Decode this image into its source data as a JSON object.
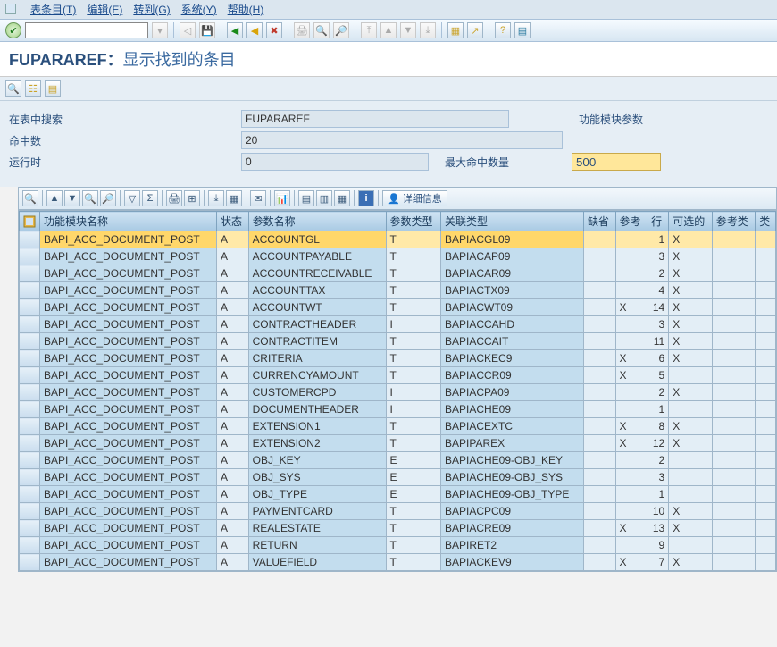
{
  "menu": {
    "items": [
      "表条目(T)",
      "编辑(E)",
      "转到(G)",
      "系统(Y)",
      "帮助(H)"
    ]
  },
  "title": {
    "name": "FUPARAREF：",
    "suffix": "显示找到的条目"
  },
  "form": {
    "search_label": "在表中搜索",
    "search_value": "FUPARAREF",
    "search_note": "功能模块参数",
    "hits_label": "命中数",
    "hits_value": "20",
    "runtime_label": "运行时",
    "runtime_value": "0",
    "maxhits_label": "最大命中数量",
    "maxhits_value": "500"
  },
  "alv_toolbar": {
    "detail_label": "详细信息"
  },
  "columns": [
    "功能模块名称",
    "状态",
    "参数名称",
    "参数类型",
    "关联类型",
    "缺省",
    "参考",
    "行",
    "可选的",
    "参考类",
    "类"
  ],
  "rows": [
    {
      "fm": "BAPI_ACC_DOCUMENT_POST",
      "st": "A",
      "pn": "ACCOUNTGL",
      "pt": "T",
      "rt": "BAPIACGL09",
      "df": "",
      "rf": "",
      "ln": "1",
      "op": "X",
      "rc": "",
      "cl": ""
    },
    {
      "fm": "BAPI_ACC_DOCUMENT_POST",
      "st": "A",
      "pn": "ACCOUNTPAYABLE",
      "pt": "T",
      "rt": "BAPIACAP09",
      "df": "",
      "rf": "",
      "ln": "3",
      "op": "X",
      "rc": "",
      "cl": ""
    },
    {
      "fm": "BAPI_ACC_DOCUMENT_POST",
      "st": "A",
      "pn": "ACCOUNTRECEIVABLE",
      "pt": "T",
      "rt": "BAPIACAR09",
      "df": "",
      "rf": "",
      "ln": "2",
      "op": "X",
      "rc": "",
      "cl": ""
    },
    {
      "fm": "BAPI_ACC_DOCUMENT_POST",
      "st": "A",
      "pn": "ACCOUNTTAX",
      "pt": "T",
      "rt": "BAPIACTX09",
      "df": "",
      "rf": "",
      "ln": "4",
      "op": "X",
      "rc": "",
      "cl": ""
    },
    {
      "fm": "BAPI_ACC_DOCUMENT_POST",
      "st": "A",
      "pn": "ACCOUNTWT",
      "pt": "T",
      "rt": "BAPIACWT09",
      "df": "",
      "rf": "X",
      "ln": "14",
      "op": "X",
      "rc": "",
      "cl": ""
    },
    {
      "fm": "BAPI_ACC_DOCUMENT_POST",
      "st": "A",
      "pn": "CONTRACTHEADER",
      "pt": "I",
      "rt": "BAPIACCAHD",
      "df": "",
      "rf": "",
      "ln": "3",
      "op": "X",
      "rc": "",
      "cl": ""
    },
    {
      "fm": "BAPI_ACC_DOCUMENT_POST",
      "st": "A",
      "pn": "CONTRACTITEM",
      "pt": "T",
      "rt": "BAPIACCAIT",
      "df": "",
      "rf": "",
      "ln": "11",
      "op": "X",
      "rc": "",
      "cl": ""
    },
    {
      "fm": "BAPI_ACC_DOCUMENT_POST",
      "st": "A",
      "pn": "CRITERIA",
      "pt": "T",
      "rt": "BAPIACKEC9",
      "df": "",
      "rf": "X",
      "ln": "6",
      "op": "X",
      "rc": "",
      "cl": ""
    },
    {
      "fm": "BAPI_ACC_DOCUMENT_POST",
      "st": "A",
      "pn": "CURRENCYAMOUNT",
      "pt": "T",
      "rt": "BAPIACCR09",
      "df": "",
      "rf": "X",
      "ln": "5",
      "op": "",
      "rc": "",
      "cl": ""
    },
    {
      "fm": "BAPI_ACC_DOCUMENT_POST",
      "st": "A",
      "pn": "CUSTOMERCPD",
      "pt": "I",
      "rt": "BAPIACPA09",
      "df": "",
      "rf": "",
      "ln": "2",
      "op": "X",
      "rc": "",
      "cl": ""
    },
    {
      "fm": "BAPI_ACC_DOCUMENT_POST",
      "st": "A",
      "pn": "DOCUMENTHEADER",
      "pt": "I",
      "rt": "BAPIACHE09",
      "df": "",
      "rf": "",
      "ln": "1",
      "op": "",
      "rc": "",
      "cl": ""
    },
    {
      "fm": "BAPI_ACC_DOCUMENT_POST",
      "st": "A",
      "pn": "EXTENSION1",
      "pt": "T",
      "rt": "BAPIACEXTC",
      "df": "",
      "rf": "X",
      "ln": "8",
      "op": "X",
      "rc": "",
      "cl": ""
    },
    {
      "fm": "BAPI_ACC_DOCUMENT_POST",
      "st": "A",
      "pn": "EXTENSION2",
      "pt": "T",
      "rt": "BAPIPAREX",
      "df": "",
      "rf": "X",
      "ln": "12",
      "op": "X",
      "rc": "",
      "cl": ""
    },
    {
      "fm": "BAPI_ACC_DOCUMENT_POST",
      "st": "A",
      "pn": "OBJ_KEY",
      "pt": "E",
      "rt": "BAPIACHE09-OBJ_KEY",
      "df": "",
      "rf": "",
      "ln": "2",
      "op": "",
      "rc": "",
      "cl": ""
    },
    {
      "fm": "BAPI_ACC_DOCUMENT_POST",
      "st": "A",
      "pn": "OBJ_SYS",
      "pt": "E",
      "rt": "BAPIACHE09-OBJ_SYS",
      "df": "",
      "rf": "",
      "ln": "3",
      "op": "",
      "rc": "",
      "cl": ""
    },
    {
      "fm": "BAPI_ACC_DOCUMENT_POST",
      "st": "A",
      "pn": "OBJ_TYPE",
      "pt": "E",
      "rt": "BAPIACHE09-OBJ_TYPE",
      "df": "",
      "rf": "",
      "ln": "1",
      "op": "",
      "rc": "",
      "cl": ""
    },
    {
      "fm": "BAPI_ACC_DOCUMENT_POST",
      "st": "A",
      "pn": "PAYMENTCARD",
      "pt": "T",
      "rt": "BAPIACPC09",
      "df": "",
      "rf": "",
      "ln": "10",
      "op": "X",
      "rc": "",
      "cl": ""
    },
    {
      "fm": "BAPI_ACC_DOCUMENT_POST",
      "st": "A",
      "pn": "REALESTATE",
      "pt": "T",
      "rt": "BAPIACRE09",
      "df": "",
      "rf": "X",
      "ln": "13",
      "op": "X",
      "rc": "",
      "cl": ""
    },
    {
      "fm": "BAPI_ACC_DOCUMENT_POST",
      "st": "A",
      "pn": "RETURN",
      "pt": "T",
      "rt": "BAPIRET2",
      "df": "",
      "rf": "",
      "ln": "9",
      "op": "",
      "rc": "",
      "cl": ""
    },
    {
      "fm": "BAPI_ACC_DOCUMENT_POST",
      "st": "A",
      "pn": "VALUEFIELD",
      "pt": "T",
      "rt": "BAPIACKEV9",
      "df": "",
      "rf": "X",
      "ln": "7",
      "op": "X",
      "rc": "",
      "cl": ""
    }
  ]
}
